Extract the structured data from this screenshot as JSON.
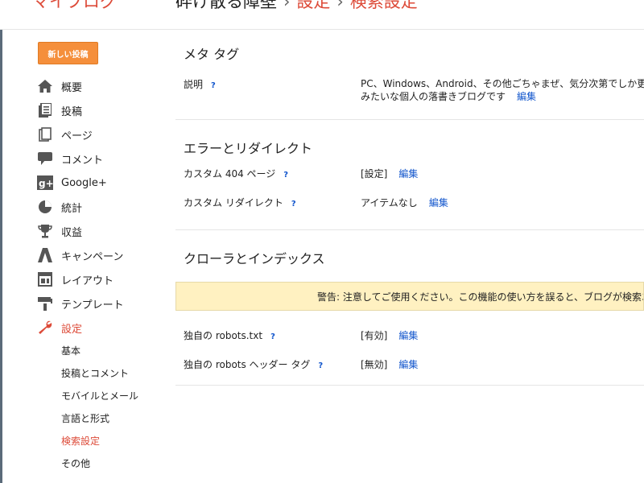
{
  "header": {
    "brand": "マイブログ",
    "blog_name": "砕け散る障壁",
    "sep": "›",
    "crumb_settings": "設定",
    "crumb_current": "検索設定"
  },
  "new_post_label": "新しい投稿",
  "nav": [
    {
      "label": "概要",
      "icon": "home-icon"
    },
    {
      "label": "投稿",
      "icon": "posts-icon"
    },
    {
      "label": "ページ",
      "icon": "pages-icon"
    },
    {
      "label": "コメント",
      "icon": "comment-icon"
    },
    {
      "label": "Google+",
      "icon": "google-plus-icon"
    },
    {
      "label": "統計",
      "icon": "stats-icon"
    },
    {
      "label": "収益",
      "icon": "trophy-icon"
    },
    {
      "label": "キャンペーン",
      "icon": "campaign-icon"
    },
    {
      "label": "レイアウト",
      "icon": "layout-icon"
    },
    {
      "label": "テンプレート",
      "icon": "template-icon"
    },
    {
      "label": "設定",
      "icon": "wrench-icon",
      "active": true
    }
  ],
  "sub_nav": [
    {
      "label": "基本"
    },
    {
      "label": "投稿とコメント"
    },
    {
      "label": "モバイルとメール"
    },
    {
      "label": "言語と形式"
    },
    {
      "label": "検索設定",
      "active": true
    },
    {
      "label": "その他"
    }
  ],
  "meta": {
    "title": "メタ タグ",
    "desc_label": "説明",
    "q": "?",
    "desc_line1": "PC、Windows、Android、その他ごちゃまぜ、気分次第でしか更新",
    "desc_line2": "みたいな個人の落書きブログです",
    "edit": "編集"
  },
  "errors": {
    "title": "エラーとリダイレクト",
    "rows": [
      {
        "label": "カスタム 404 ページ",
        "q": "?",
        "value": "[設定]",
        "edit": "編集"
      },
      {
        "label": "カスタム リダイレクト",
        "q": "?",
        "value": "アイテムなし",
        "edit": "編集"
      }
    ]
  },
  "crawlers": {
    "title": "クローラとインデックス",
    "warning": "警告: 注意してご使用ください。この機能の使い方を誤ると、ブログが検索エ",
    "rows": [
      {
        "label": "独自の robots.txt",
        "q": "?",
        "value": "[有効]",
        "edit": "編集"
      },
      {
        "label": "独自の robots ヘッダー タグ",
        "q": "?",
        "value": "[無効]",
        "edit": "編集"
      }
    ]
  },
  "colors": {
    "accent": "#dd4b39",
    "button": "#f58f3b",
    "link": "#1155cc",
    "warning_bg": "#fff1c1"
  }
}
